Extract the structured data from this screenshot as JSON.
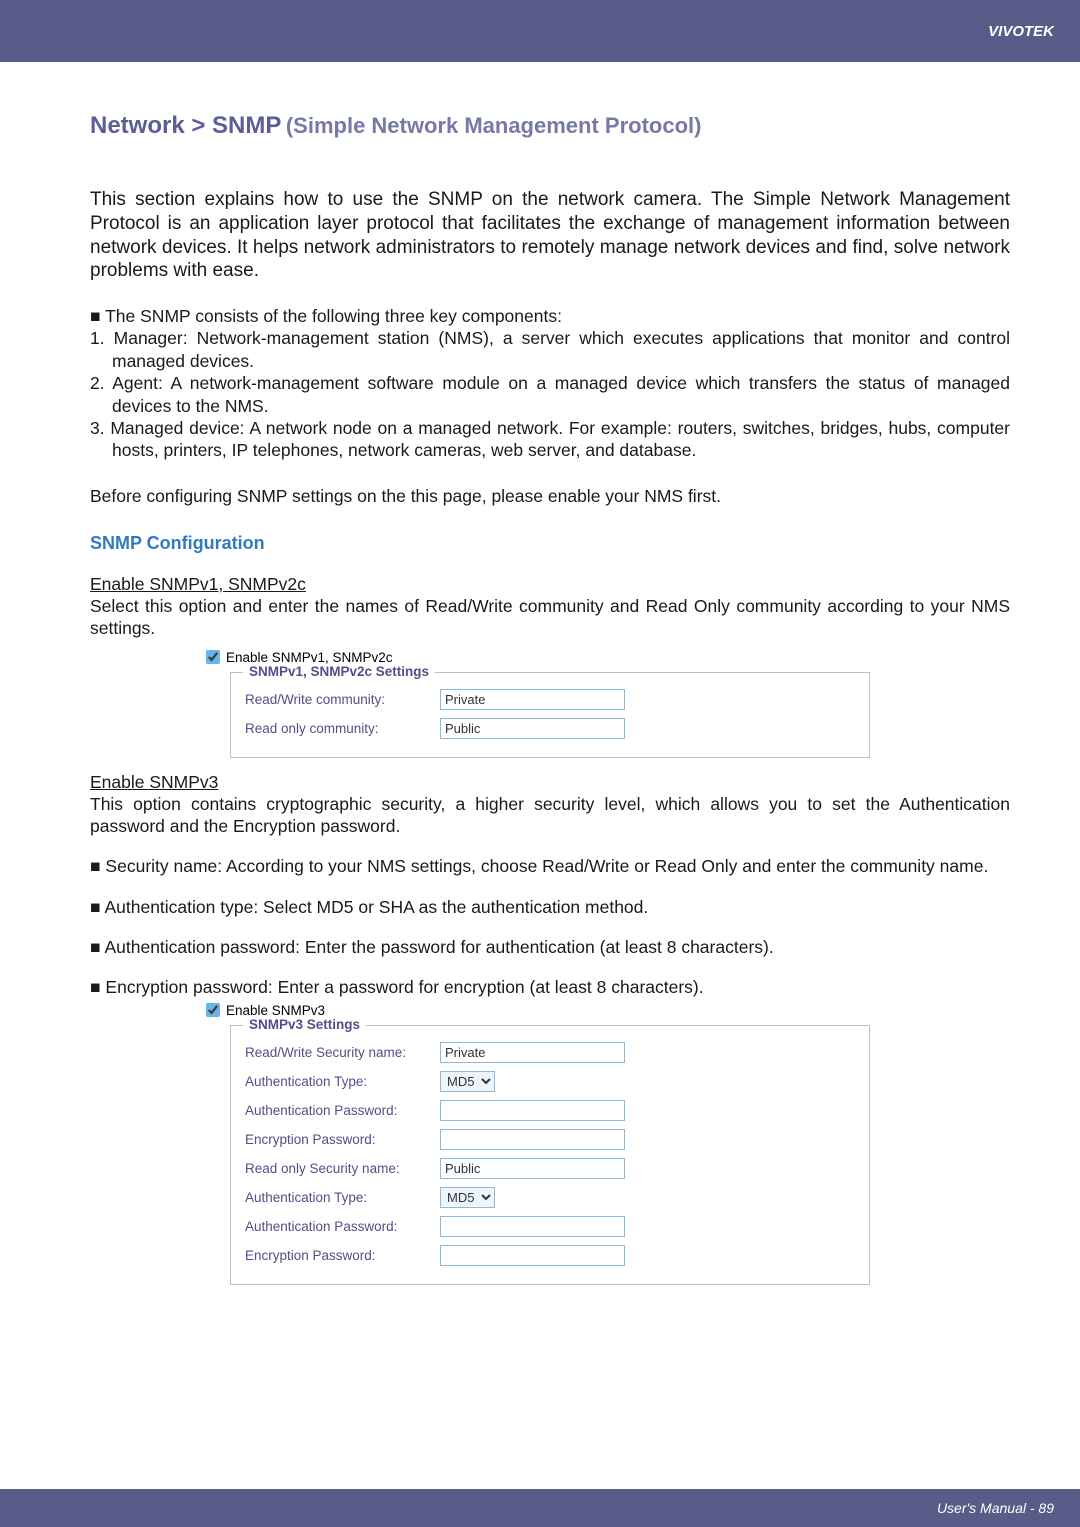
{
  "header": {
    "brand": "VIVOTEK"
  },
  "title": {
    "main": "Network > SNMP",
    "sub": "(Simple Network Management Protocol)"
  },
  "intro": "This section explains how to use the SNMP on the network camera. The Simple Network Management Protocol is an application layer protocol that facilitates the exchange of management information between network devices. It helps network administrators to remotely manage network devices and find, solve network problems with ease.",
  "components": {
    "lead": "■ The SNMP consists of the following three key components:",
    "item1": "1. Manager: Network-management station (NMS), a server which executes applications that monitor and control managed devices.",
    "item2": "2. Agent: A network-management software module on a managed device which transfers the status of managed devices to the NMS.",
    "item3": "3. Managed device: A network node on a managed network. For example: routers, switches, bridges, hubs, computer hosts, printers, IP telephones, network cameras, web server, and database."
  },
  "before_config": "Before configuring SNMP settings on the this page, please enable your NMS first.",
  "snmp_config_title": "SNMP Configuration",
  "v2c": {
    "heading": "Enable SNMPv1, SNMPv2c",
    "desc": "Select this option and enter the names of Read/Write community and Read Only community according to your NMS settings.",
    "checkbox_label": "Enable SNMPv1, SNMPv2c",
    "legend": "SNMPv1, SNMPv2c Settings",
    "rw_label": "Read/Write community:",
    "rw_value": "Private",
    "ro_label": "Read only community:",
    "ro_value": "Public"
  },
  "v3": {
    "heading": "Enable SNMPv3",
    "desc": "This option contains cryptographic security, a higher security level, which allows you to set the Authentication password and the Encryption password.",
    "bullet_sec": "■ Security name: According to your NMS settings, choose Read/Write or Read Only and enter the community name.",
    "bullet_auth_type": "■ Authentication type: Select MD5 or SHA as the authentication method.",
    "bullet_auth_pwd": "■ Authentication password: Enter the password for authentication (at least 8 characters).",
    "bullet_enc_pwd": "■ Encryption password: Enter a password for encryption (at least 8 characters).",
    "checkbox_label": "Enable SNMPv3",
    "legend": "SNMPv3 Settings",
    "rw_sec_label": "Read/Write Security name:",
    "rw_sec_value": "Private",
    "auth_type_label1": "Authentication Type:",
    "auth_type_value1": "MD5",
    "auth_pwd_label1": "Authentication Password:",
    "enc_pwd_label1": "Encryption Password:",
    "ro_sec_label": "Read only Security name:",
    "ro_sec_value": "Public",
    "auth_type_label2": "Authentication Type:",
    "auth_type_value2": "MD5",
    "auth_pwd_label2": "Authentication Password:",
    "enc_pwd_label2": "Encryption Password:"
  },
  "footer": {
    "text": "User's Manual - 89"
  }
}
